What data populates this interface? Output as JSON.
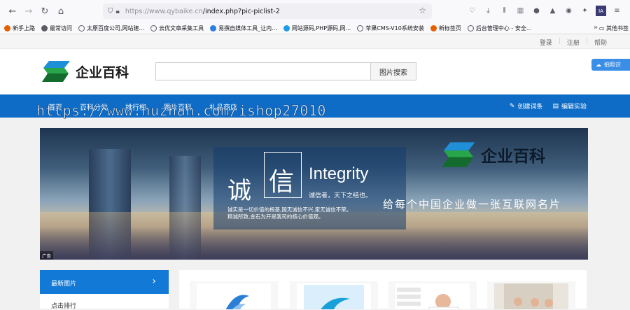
{
  "browser": {
    "url_host": "https://www.qybaike.cn",
    "url_path": "/index.php?pic-piclist-2",
    "bookmarks": [
      "新手上路",
      "最常访问",
      "太原百度公司,网站建...",
      "云优文章采集工具",
      "易撰自媒体工具_让内...",
      "网站源码,PHP源码,网...",
      "苹果CMS-V10系统安装",
      "新标签页",
      "后台管理中心 - 安全..."
    ],
    "bookmark_more": "»",
    "other_bookmarks": "其他书签"
  },
  "topbar": {
    "login": "登录",
    "register": "注册",
    "help": "帮助"
  },
  "header": {
    "logo_text": "企业百科",
    "search_placeholder": "",
    "search_button": "图片搜索",
    "side_badge": "拍照识"
  },
  "nav": {
    "items": [
      "首页",
      "百科分类",
      "排行榜",
      "图片百科",
      "礼品商店"
    ],
    "create_entry": "创建词条",
    "edit_lab": "编辑实验"
  },
  "watermark": "https://www.huzhan.com/ishop27010",
  "banner": {
    "char1": "诚",
    "char2": "信",
    "integrity": "Integrity",
    "integrity_sub": "诚信者，天下之结也。",
    "paragraph_1": "诚实是一切价值的根基,国无诚信不兴,家无诚信不荣。",
    "paragraph_2": "精诚所致,金石为开是我司的核心价值观。",
    "logo_text": "企业百科",
    "slogan": "给每个中国企业做一张互联网名片",
    "ad_tag": "广告"
  },
  "sidebar": {
    "active": "最新图片",
    "active_arrow": "›",
    "item2": "点击排行"
  },
  "colors": {
    "nav_blue": "#0f6cc6",
    "side_active": "#1379d6",
    "logo_green": "#2aa64a"
  }
}
